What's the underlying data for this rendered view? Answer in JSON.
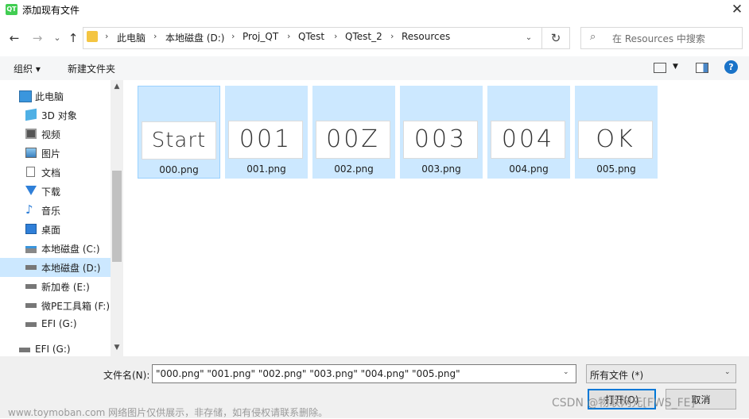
{
  "window": {
    "title": "添加现有文件",
    "app_icon": "QT",
    "close_glyph": "✕"
  },
  "nav": {
    "back": "←",
    "forward": "→",
    "recent": "⌄",
    "up": "↑"
  },
  "breadcrumb": [
    "此电脑",
    "本地磁盘 (D:)",
    "Proj_QT",
    "QTest",
    "QTest_2",
    "Resources"
  ],
  "address": {
    "separator": "›",
    "dropdown": "⌄",
    "refresh": "↻"
  },
  "search": {
    "placeholder": "在 Resources 中搜索",
    "icon": "⌕"
  },
  "toolbar": {
    "organize": "组织 ▾",
    "new_folder": "新建文件夹",
    "view_dropdown": "▼",
    "help": "?"
  },
  "sidebar": {
    "items": [
      {
        "label": "此电脑",
        "icon": "computer-icon"
      },
      {
        "label": "3D 对象",
        "icon": "cube-icon"
      },
      {
        "label": "视频",
        "icon": "video-icon"
      },
      {
        "label": "图片",
        "icon": "picture-icon"
      },
      {
        "label": "文档",
        "icon": "document-icon"
      },
      {
        "label": "下载",
        "icon": "download-icon"
      },
      {
        "label": "音乐",
        "icon": "music-icon"
      },
      {
        "label": "桌面",
        "icon": "desktop-icon"
      },
      {
        "label": "本地磁盘 (C:)",
        "icon": "drive-icon"
      },
      {
        "label": "本地磁盘 (D:)",
        "icon": "drive-icon",
        "selected": true
      },
      {
        "label": "新加卷 (E:)",
        "icon": "drive-icon"
      },
      {
        "label": "微PE工具箱 (F:)",
        "icon": "drive-icon"
      },
      {
        "label": "EFI (G:)",
        "icon": "drive-icon"
      },
      {
        "label": "EFI (G:)",
        "icon": "drive-icon"
      }
    ],
    "scroll_up": "▲",
    "scroll_down": "▼"
  },
  "files": [
    {
      "name": "000.png",
      "thumb_text": "Start"
    },
    {
      "name": "001.png",
      "thumb_text": "001"
    },
    {
      "name": "002.png",
      "thumb_text": "00Z"
    },
    {
      "name": "003.png",
      "thumb_text": "003"
    },
    {
      "name": "004.png",
      "thumb_text": "004"
    },
    {
      "name": "005.png",
      "thumb_text": "OK"
    }
  ],
  "bottom": {
    "filename_label": "文件名(N):",
    "filename_value": "\"000.png\" \"001.png\" \"002.png\" \"003.png\" \"004.png\" \"005.png\"",
    "filetype_value": "所有文件 (*)",
    "open_label": "打开(O)",
    "cancel_label": "取消",
    "dropdown": "⌄"
  },
  "watermarks": {
    "left": "www.toymoban.com 网络图片仅供展示，非存储，如有侵权请联系删除。",
    "right": "CSDN @物联网元[FWS_FE]"
  },
  "colors": {
    "selection": "#cce8ff",
    "accent": "#0078d7",
    "qt_green": "#41cd52"
  }
}
